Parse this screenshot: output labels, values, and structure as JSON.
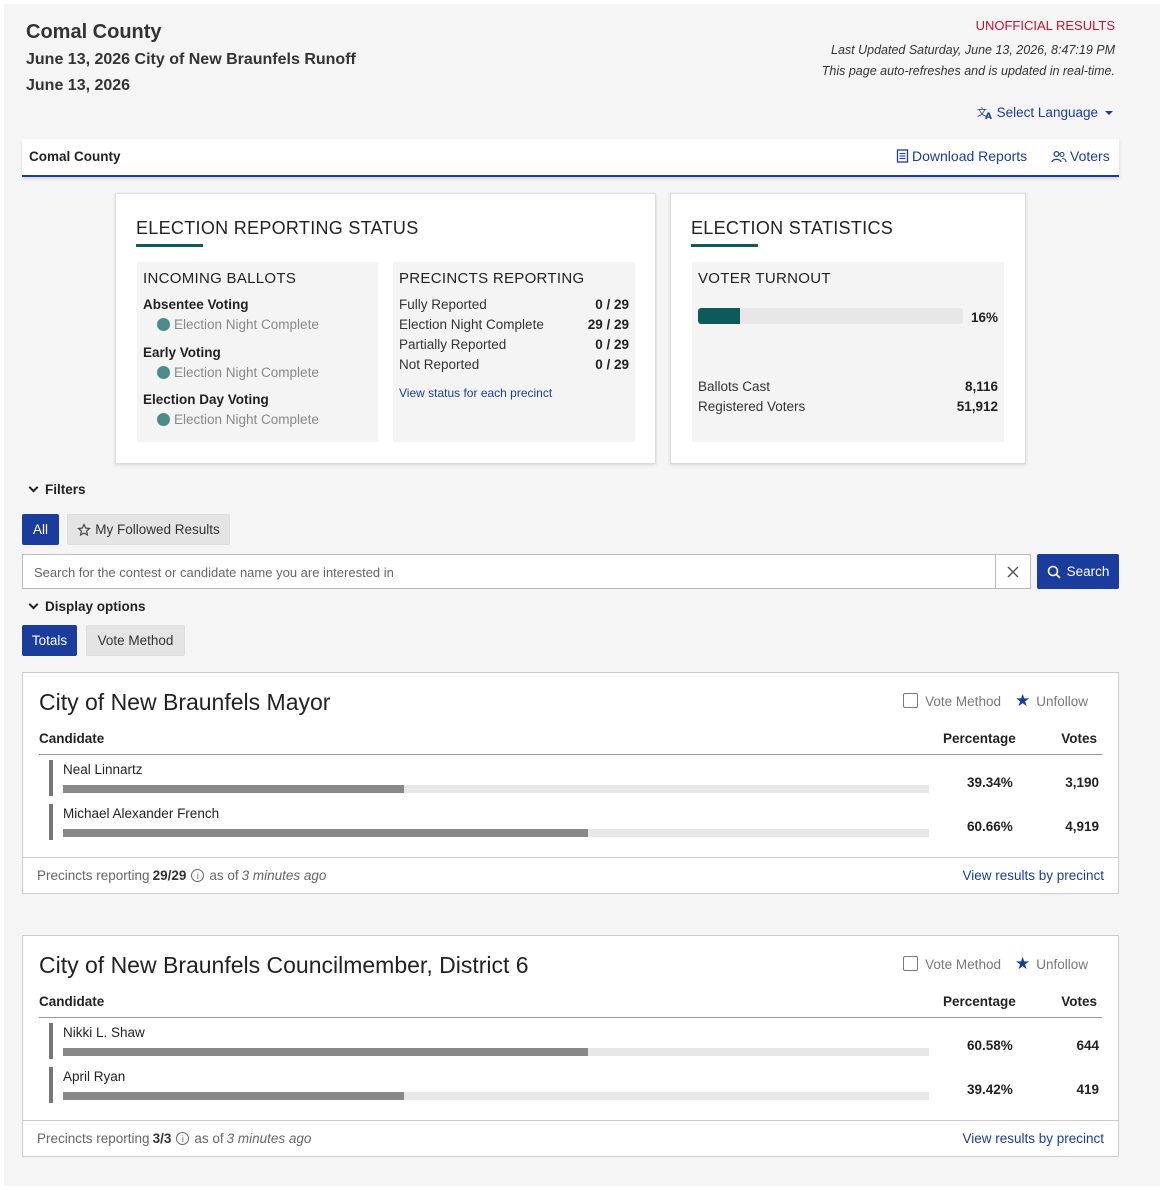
{
  "header": {
    "county": "Comal County",
    "election_name": "June 13, 2026 City of New Braunfels Runoff",
    "election_date": "June 13, 2026",
    "unofficial": "UNOFFICIAL RESULTS",
    "last_updated": "Last Updated Saturday, June 13, 2026, 8:47:19 PM",
    "autorefresh": "This page auto-refreshes and is updated in real-time.",
    "select_language": "Select Language"
  },
  "navbar": {
    "county": "Comal County",
    "download_reports": "Download Reports",
    "voters": "Voters"
  },
  "reporting_status": {
    "title": "ELECTION REPORTING STATUS",
    "incoming": {
      "title": "INCOMING BALLOTS",
      "items": [
        {
          "label": "Absentee Voting",
          "status": "Election Night Complete"
        },
        {
          "label": "Early Voting",
          "status": "Election Night Complete"
        },
        {
          "label": "Election Day Voting",
          "status": "Election Night Complete"
        }
      ]
    },
    "precincts": {
      "title": "PRECINCTS REPORTING",
      "rows": [
        {
          "label": "Fully Reported",
          "value": "0 / 29"
        },
        {
          "label": "Election Night Complete",
          "value": "29 / 29"
        },
        {
          "label": "Partially Reported",
          "value": "0 / 29"
        },
        {
          "label": "Not Reported",
          "value": "0 / 29"
        }
      ],
      "link": "View status for each precinct"
    }
  },
  "statistics": {
    "title": "ELECTION STATISTICS",
    "turnout_title": "VOTER TURNOUT",
    "turnout_pct": "16%",
    "turnout_fraction": 0.16,
    "ballots_cast_label": "Ballots Cast",
    "ballots_cast": "8,116",
    "registered_label": "Registered Voters",
    "registered": "51,912"
  },
  "filters": {
    "label": "Filters",
    "all": "All",
    "followed": "My Followed Results",
    "search_placeholder": "Search for the contest or candidate name you are interested in",
    "search_button": "Search",
    "display_options": "Display options",
    "totals": "Totals",
    "vote_method": "Vote Method"
  },
  "colors": {
    "brand_blue": "#1a3c9c",
    "teal": "#0e5959",
    "unofficial_red": "#c8102e"
  },
  "contests": [
    {
      "title": "City of New Braunfels Mayor",
      "vote_method": "Vote Method",
      "unfollow": "Unfollow",
      "col_candidate": "Candidate",
      "col_percentage": "Percentage",
      "col_votes": "Votes",
      "candidates": [
        {
          "name": "Neal Linnartz",
          "pct": "39.34%",
          "votes": "3,190",
          "share": 0.3934
        },
        {
          "name": "Michael Alexander French",
          "pct": "60.66%",
          "votes": "4,919",
          "share": 0.6066
        }
      ],
      "footer_prefix": "Precincts reporting",
      "footer_count": "29/29",
      "footer_asof": "as of",
      "footer_time": "3 minutes ago",
      "footer_link": "View results by precinct"
    },
    {
      "title": "City of New Braunfels Councilmember, District 6",
      "vote_method": "Vote Method",
      "unfollow": "Unfollow",
      "col_candidate": "Candidate",
      "col_percentage": "Percentage",
      "col_votes": "Votes",
      "candidates": [
        {
          "name": "Nikki L. Shaw",
          "pct": "60.58%",
          "votes": "644",
          "share": 0.6058
        },
        {
          "name": "April Ryan",
          "pct": "39.42%",
          "votes": "419",
          "share": 0.3942
        }
      ],
      "footer_prefix": "Precincts reporting",
      "footer_count": "3/3",
      "footer_asof": "as of",
      "footer_time": "3 minutes ago",
      "footer_link": "View results by precinct"
    }
  ]
}
